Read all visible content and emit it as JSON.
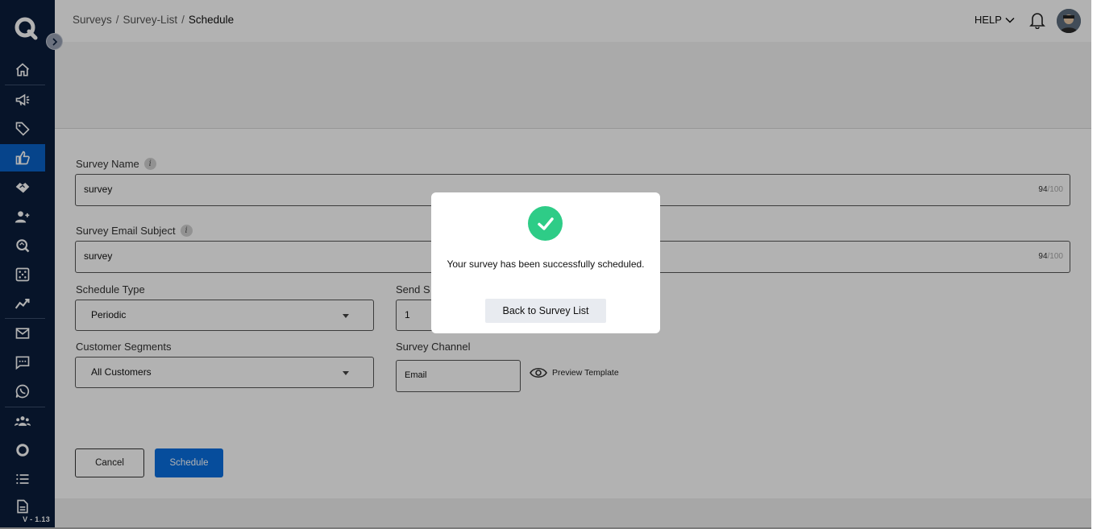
{
  "breadcrumb": {
    "items": [
      "Surveys",
      "Survey-List",
      "Schedule"
    ],
    "separator": "/"
  },
  "header": {
    "help_label": "HELP"
  },
  "sidebar": {
    "version": "V - 1.13",
    "icons": [
      "home-icon",
      "megaphone-icon",
      "tag-icon",
      "thumbs-up-icon",
      "handshake-icon",
      "user-add-icon",
      "search-insight-icon",
      "dice-icon",
      "trend-icon",
      "mail-icon",
      "chat-icon",
      "whatsapp-icon",
      "group-icon",
      "circle-icon",
      "list-icon",
      "document-icon"
    ],
    "active": "thumbs-up-icon"
  },
  "form": {
    "survey_name_label": "Survey Name",
    "survey_name_value": "survey",
    "survey_name_count": "94",
    "survey_name_max": "/100",
    "email_subject_label": "Survey Email Subject",
    "email_subject_value": "survey",
    "email_subject_count": "94",
    "email_subject_max": "/100",
    "schedule_type_label": "Schedule Type",
    "schedule_type_value": "Periodic",
    "send_label": "Send S",
    "send_value": "1",
    "segments_label": "Customer Segments",
    "segments_value": "All Customers",
    "channel_label": "Survey Channel",
    "channel_value": "Email",
    "preview_label": "Preview Template",
    "info_glyph": "i"
  },
  "actions": {
    "cancel_label": "Cancel",
    "schedule_label": "Schedule"
  },
  "modal": {
    "message": "Your survey has been successfully scheduled.",
    "back_label": "Back to Survey List"
  },
  "colors": {
    "sidebar_bg": "#0b1e3b",
    "active_nav": "#0a62c7",
    "primary": "#0a6fe0",
    "success": "#2ecc87"
  }
}
